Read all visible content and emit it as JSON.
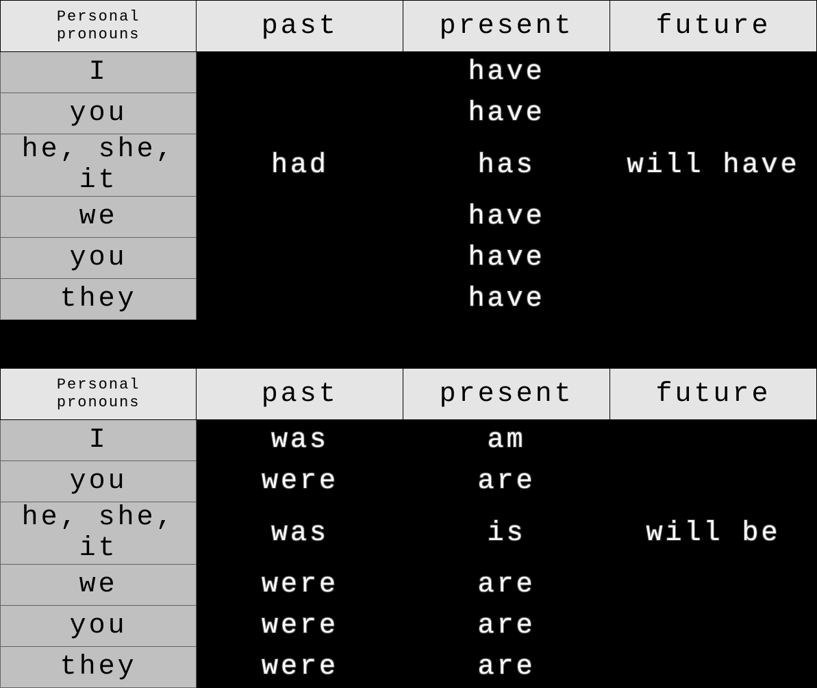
{
  "tables": [
    {
      "corner": "Personal\npronouns",
      "headers": [
        "past",
        "present",
        "future"
      ],
      "rows": [
        {
          "pronoun": "I",
          "past": "",
          "present": "have",
          "future": ""
        },
        {
          "pronoun": "you",
          "past": "",
          "present": "have",
          "future": ""
        },
        {
          "pronoun": "he, she, it",
          "past": "had",
          "present": "has",
          "future": "will have"
        },
        {
          "pronoun": "we",
          "past": "",
          "present": "have",
          "future": ""
        },
        {
          "pronoun": "you",
          "past": "",
          "present": "have",
          "future": ""
        },
        {
          "pronoun": "they",
          "past": "",
          "present": "have",
          "future": ""
        }
      ]
    },
    {
      "corner": "Personal\npronouns",
      "headers": [
        "past",
        "present",
        "future"
      ],
      "rows": [
        {
          "pronoun": "I",
          "past": "was",
          "present": "am",
          "future": ""
        },
        {
          "pronoun": "you",
          "past": "were",
          "present": "are",
          "future": ""
        },
        {
          "pronoun": "he, she, it",
          "past": "was",
          "present": "is",
          "future": "will be"
        },
        {
          "pronoun": "we",
          "past": "were",
          "present": "are",
          "future": ""
        },
        {
          "pronoun": "you",
          "past": "were",
          "present": "are",
          "future": ""
        },
        {
          "pronoun": "they",
          "past": "were",
          "present": "are",
          "future": ""
        }
      ]
    }
  ]
}
